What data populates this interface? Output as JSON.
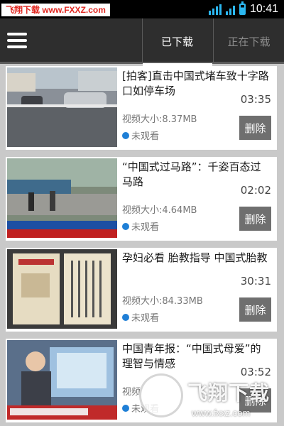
{
  "status_bar": {
    "watermark": "飞翔下载 www.FXXZ.com",
    "time": "10:41"
  },
  "header": {
    "menu_icon": "menu-icon",
    "tabs": [
      {
        "label": "已下载",
        "active": true
      },
      {
        "label": "正在下载",
        "active": false
      }
    ]
  },
  "videos": [
    {
      "title": "[拍客]直击中国式堵车致十字路口如停车场",
      "duration": "03:35",
      "size": "视频大小:8.37MB",
      "status": "未观看",
      "delete": "删除"
    },
    {
      "title": "“中国式过马路”：千姿百态过马路",
      "duration": "02:02",
      "size": "视频大小:4.64MB",
      "status": "未观看",
      "delete": "删除"
    },
    {
      "title": "孕妇必看 胎教指导 中国式胎教",
      "duration": "30:31",
      "size": "视频大小:84.33MB",
      "status": "未观看",
      "delete": "删除"
    },
    {
      "title": "中国青年报：“中国式母爱”的理智与情感",
      "duration": "03:52",
      "size": "视频",
      "status": "未观看",
      "delete": "删除"
    }
  ],
  "watermark_bottom": {
    "brand": "飞翔下载",
    "url": "www.fxxz.com"
  },
  "colors": {
    "header_bg": "#2e2e2e",
    "status_dot": "#1f7fd6",
    "delete_bg": "#6f6f6f",
    "list_bg": "#c9c9c9"
  }
}
